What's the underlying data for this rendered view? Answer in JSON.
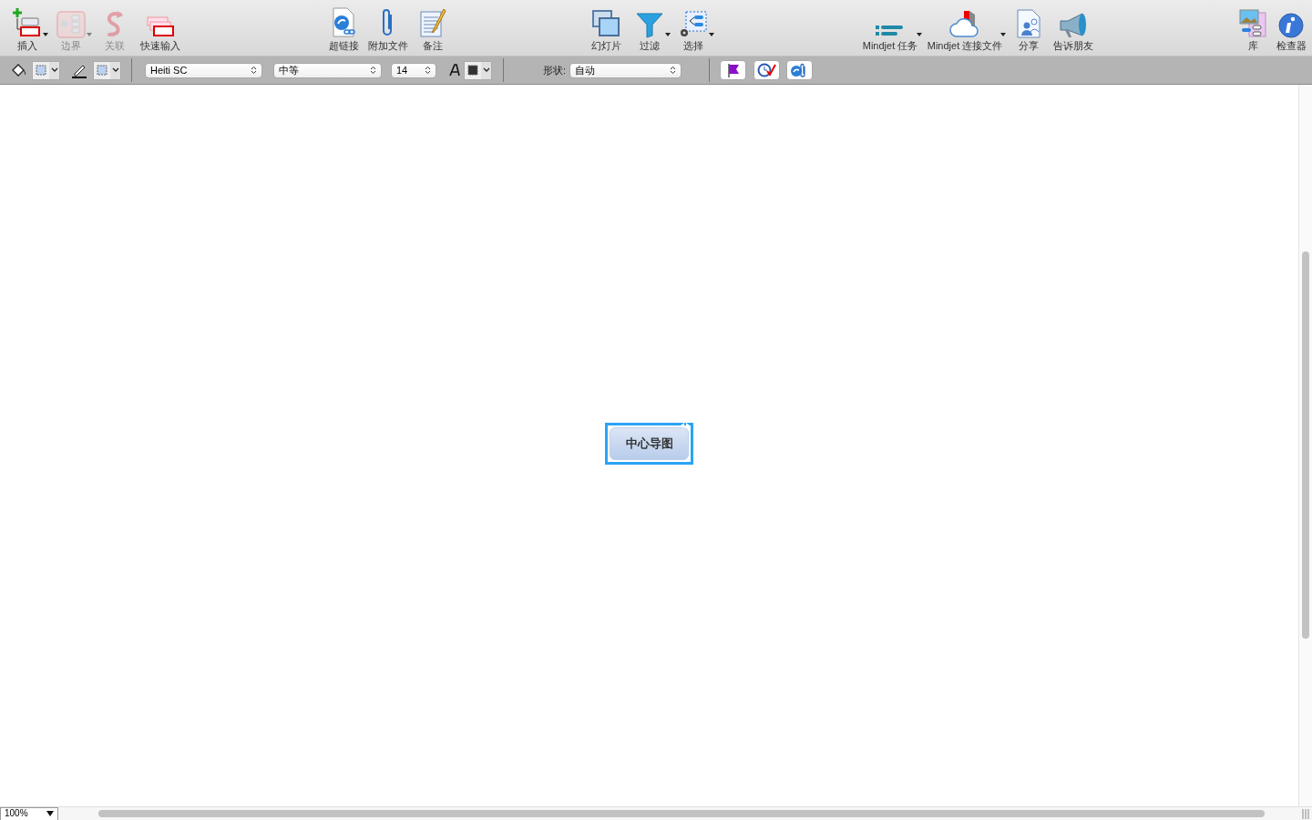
{
  "toolbar": {
    "groups": [
      {
        "buttons": [
          {
            "kind": "insert",
            "label": "插入",
            "disabled": false,
            "dropdown": true
          },
          {
            "kind": "boundary",
            "label": "边界",
            "disabled": true,
            "dropdown": true
          },
          {
            "kind": "relation",
            "label": "关联",
            "disabled": true,
            "dropdown": false
          },
          {
            "kind": "quick",
            "label": "快速输入",
            "disabled": false,
            "dropdown": false
          }
        ]
      },
      {
        "buttons": [
          {
            "kind": "hyperlink",
            "label": "超链接",
            "disabled": false,
            "dropdown": false
          },
          {
            "kind": "attach",
            "label": "附加文件",
            "disabled": false,
            "dropdown": false
          },
          {
            "kind": "notes",
            "label": "备注",
            "disabled": false,
            "dropdown": false
          }
        ]
      },
      {
        "buttons": [
          {
            "kind": "slides",
            "label": "幻灯片",
            "disabled": false,
            "dropdown": false
          },
          {
            "kind": "filter",
            "label": "过滤",
            "disabled": false,
            "dropdown": true
          },
          {
            "kind": "select",
            "label": "选择",
            "disabled": false,
            "dropdown": true
          }
        ]
      },
      {
        "buttons": [
          {
            "kind": "tasks",
            "label": "Mindjet 任务",
            "disabled": false,
            "dropdown": true
          },
          {
            "kind": "connect",
            "label": "Mindjet 连接文件",
            "disabled": false,
            "dropdown": true
          },
          {
            "kind": "share",
            "label": "分享",
            "disabled": false,
            "dropdown": false
          },
          {
            "kind": "tell",
            "label": "告诉朋友",
            "disabled": false,
            "dropdown": false
          }
        ]
      },
      {
        "buttons": [
          {
            "kind": "library",
            "label": "库",
            "disabled": false,
            "dropdown": false
          },
          {
            "kind": "inspector",
            "label": "检查器",
            "disabled": false,
            "dropdown": false
          }
        ]
      }
    ]
  },
  "format_bar": {
    "font": "Heiti SC",
    "weight": "中等",
    "size": "14",
    "shape_label": "形状:",
    "shape": "自动"
  },
  "canvas": {
    "central_topic": {
      "label": "中心导图",
      "selected": true
    }
  },
  "status_bar": {
    "zoom": "100%"
  }
}
